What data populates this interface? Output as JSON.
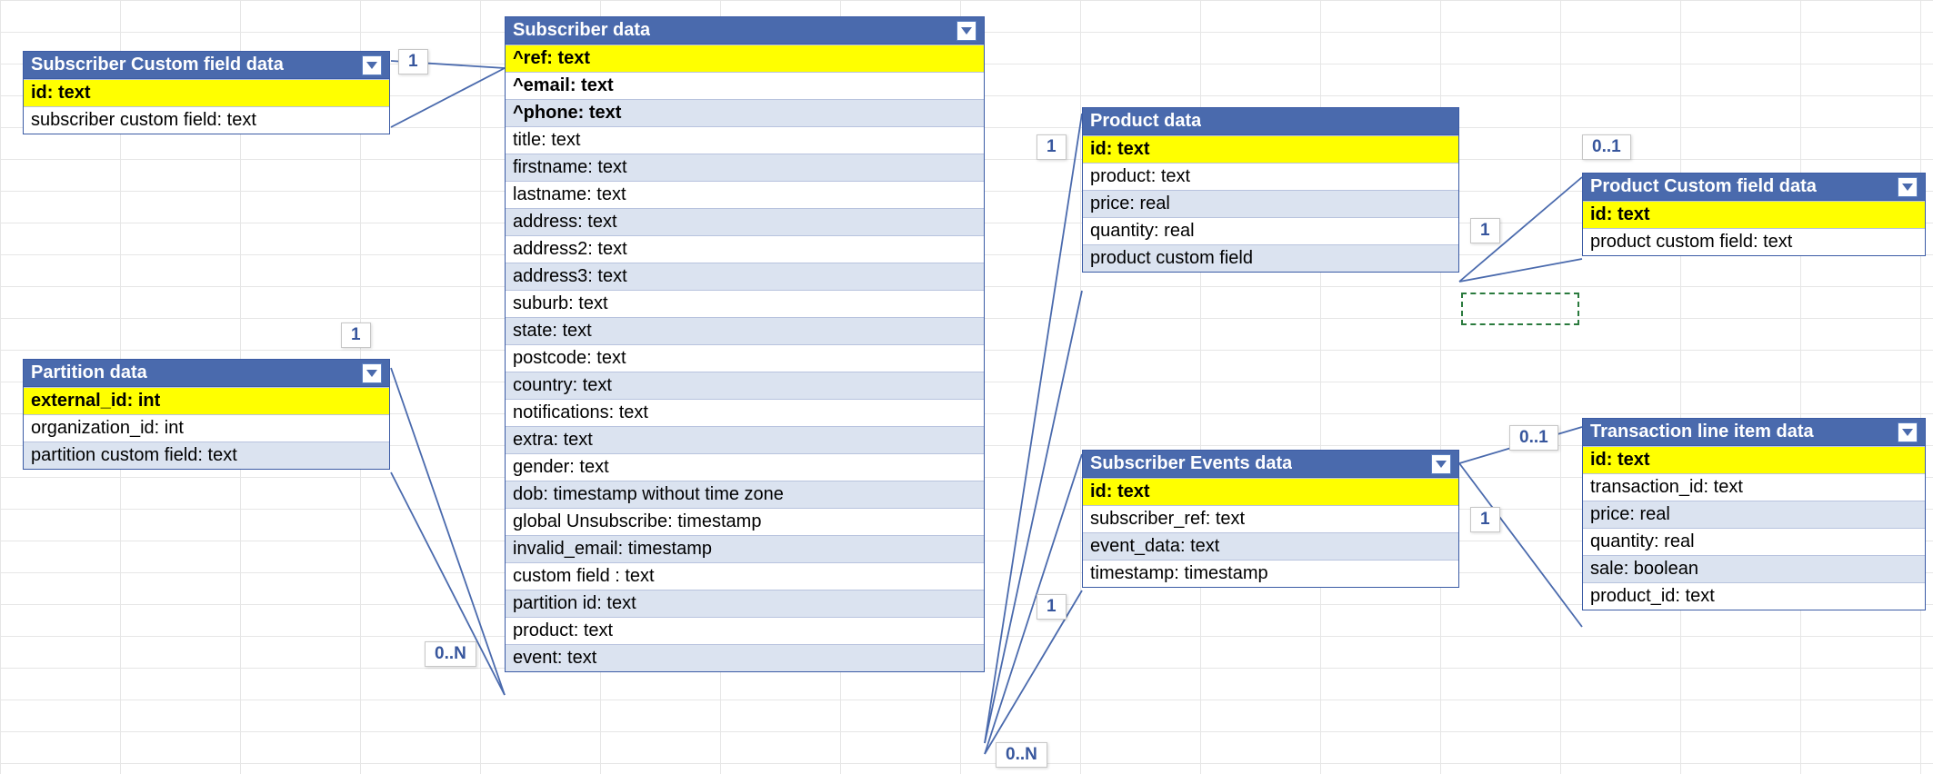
{
  "entities": {
    "subscriber_custom_field": {
      "title": "Subscriber Custom field data",
      "fields": [
        "id: text",
        "subscriber custom field: text"
      ]
    },
    "partition": {
      "title": "Partition data",
      "fields": [
        "external_id: int",
        "organization_id: int",
        "partition custom field: text"
      ]
    },
    "subscriber": {
      "title": "Subscriber data",
      "fields": [
        "^ref: text",
        "^email: text",
        "^phone: text",
        "title: text",
        "firstname: text",
        "lastname: text",
        "address: text",
        "address2: text",
        "address3: text",
        "suburb: text",
        "state: text",
        "postcode: text",
        "country: text",
        "notifications: text",
        "extra: text",
        "gender: text",
        "dob: timestamp without time zone",
        "global Unsubscribe: timestamp",
        "invalid_email: timestamp",
        "custom field : text",
        "partition id: text",
        "product: text",
        "event: text"
      ]
    },
    "product": {
      "title": "Product data",
      "fields": [
        "id: text",
        "product: text",
        "price: real",
        "quantity: real",
        "product custom field"
      ]
    },
    "subscriber_events": {
      "title": "Subscriber Events data",
      "fields": [
        "id: text",
        "subscriber_ref: text",
        "event_data: text",
        "timestamp: timestamp"
      ]
    },
    "product_custom_field": {
      "title": "Product Custom field data",
      "fields": [
        "id: text",
        "product custom field: text"
      ]
    },
    "transaction_line_item": {
      "title": "Transaction line item data",
      "fields": [
        "id: text",
        "transaction_id: text",
        "price: real",
        "quantity: real",
        "sale: boolean",
        "product_id: text"
      ]
    }
  },
  "cardinalities": {
    "c1": "1",
    "c2": "1",
    "c3": "0..N",
    "c4": "1",
    "c5": "0..N",
    "c6": "1",
    "c7": "1",
    "c8": "0..1",
    "c9": "1",
    "c10": "0..1"
  }
}
